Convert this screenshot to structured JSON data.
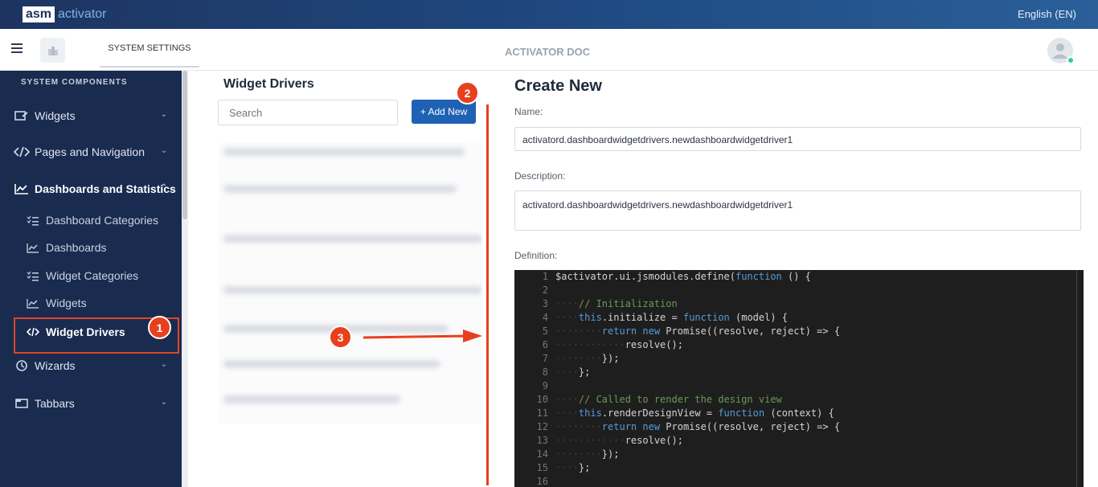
{
  "brand": {
    "part1": "asm",
    "part2": "activator"
  },
  "language": "English (EN)",
  "header": {
    "tab": "SYSTEM SETTINGS",
    "title": "ACTIVATOR DOC"
  },
  "sidebar": {
    "heading": "SYSTEM COMPONENTS",
    "items": [
      {
        "label": "Widgets",
        "icon": "widgets-icon"
      },
      {
        "label": "Pages and Navigation",
        "icon": "code-icon"
      },
      {
        "label": "Dashboards and Statistics",
        "icon": "chart-line-icon"
      },
      {
        "label": "Wizards",
        "icon": "wizard-icon"
      },
      {
        "label": "Tabbars",
        "icon": "tabbar-icon"
      }
    ],
    "subitems": [
      {
        "label": "Dashboard Categories",
        "icon": "list-check-icon"
      },
      {
        "label": "Dashboards",
        "icon": "chart-line-icon"
      },
      {
        "label": "Widget Categories",
        "icon": "list-check-icon"
      },
      {
        "label": "Widgets",
        "icon": "chart-line-icon"
      },
      {
        "label": "Widget Drivers",
        "icon": "code-icon"
      }
    ]
  },
  "badges": {
    "one": "1",
    "two": "2",
    "three": "3"
  },
  "list": {
    "title": "Widget Drivers",
    "search_placeholder": "Search",
    "add_button": "+ Add New"
  },
  "form": {
    "title": "Create New",
    "name_label": "Name:",
    "name_value": "activatord.dashboardwidgetdrivers.newdashboardwidgetdriver1",
    "description_label": "Description:",
    "description_value": "activatord.dashboardwidgetdrivers.newdashboardwidgetdriver1",
    "definition_label": "Definition:"
  },
  "code_lines": [
    "$activator.ui.jsmodules.define(function () {",
    "",
    "    // Initialization",
    "    this.initialize = function (model) {",
    "        return new Promise((resolve, reject) => {",
    "            resolve();",
    "        });",
    "    };",
    "",
    "    // Called to render the design view",
    "    this.renderDesignView = function (context) {",
    "        return new Promise((resolve, reject) => {",
    "            resolve();",
    "        });",
    "    };",
    ""
  ],
  "colors": {
    "accent": "#1f62b4",
    "sidebar": "#1a2b50",
    "annotation": "#e8401c"
  }
}
